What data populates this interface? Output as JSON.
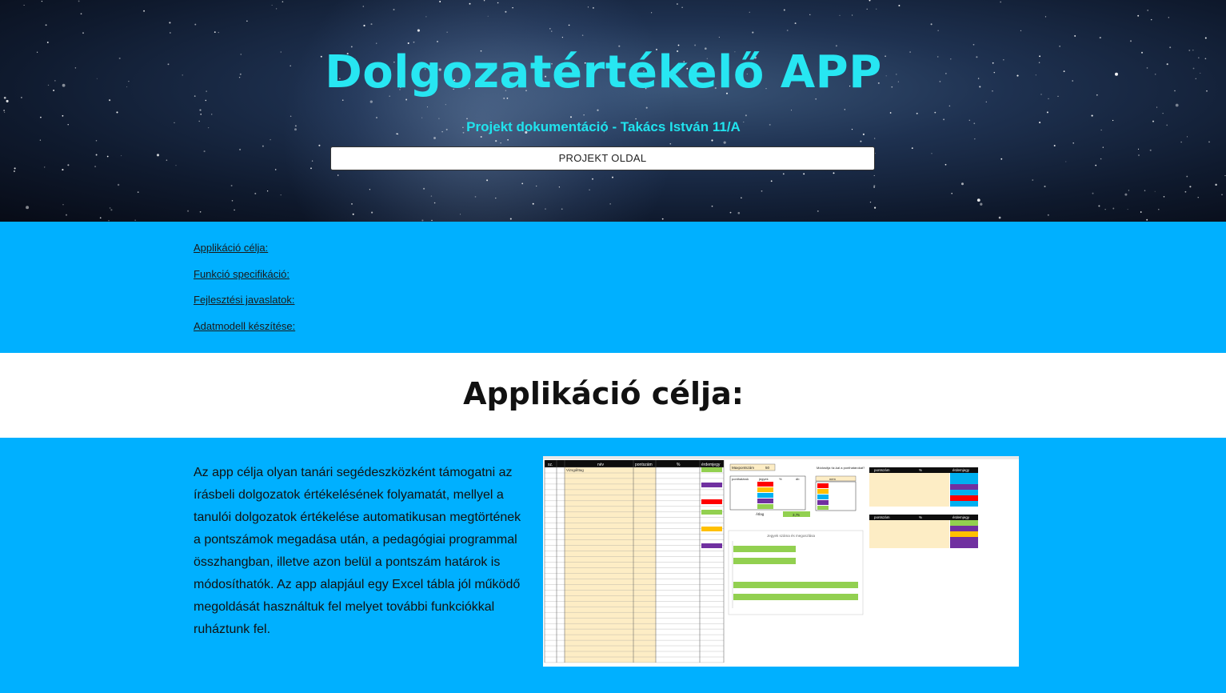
{
  "hero": {
    "title": "Dolgozatértékelő APP",
    "subtitle": "Projekt dokumentáció - Takács István 11/A",
    "button_label": "PROJEKT OLDAL"
  },
  "nav": {
    "items": [
      {
        "label": "Applikáció célja:"
      },
      {
        "label": "Funkció specifikáció:"
      },
      {
        "label": "Fejlesztési javaslatok:"
      },
      {
        "label": "Adatmodell készítése:"
      }
    ]
  },
  "section": {
    "title": "Applikáció célja:",
    "text": " Az app célja olyan tanári segédeszközként támogatni az írásbeli dolgozatok értékelésének folyamatát, mellyel a tanulói dolgozatok értékelése automatikusan megtörtének a pontszámok megadása után, a pedagógiai programmal összhangban, illetve azon belül a pontszám határok is módosíthatók. Az app alapjául egy Excel tábla jól működő megoldását használtuk fel melyet további funkciókkal ruháztunk fel."
  },
  "spreadsheet": {
    "headers": [
      "sz.",
      "név",
      "pontszám",
      "%",
      "érdemjegy"
    ],
    "first_name": "Vizsgálttag",
    "maxpont_label": "Maxpontszám",
    "maxpont_value": "50",
    "score_table_headers": [
      "ponthatárok",
      "jegyek",
      "%",
      "db"
    ],
    "modify_label": "Módosítja tíz-kal a ponthatárokat?",
    "modify_value": "nem",
    "chart_title": "Jegyek száma és megoszlása",
    "avg_label": "Átlag",
    "avg_value": "3,75",
    "right_headers": [
      "pontszám",
      "%",
      "érdemjegy"
    ]
  },
  "colors": {
    "hero_text": "#27e6f2",
    "band": "#00b0ff"
  }
}
